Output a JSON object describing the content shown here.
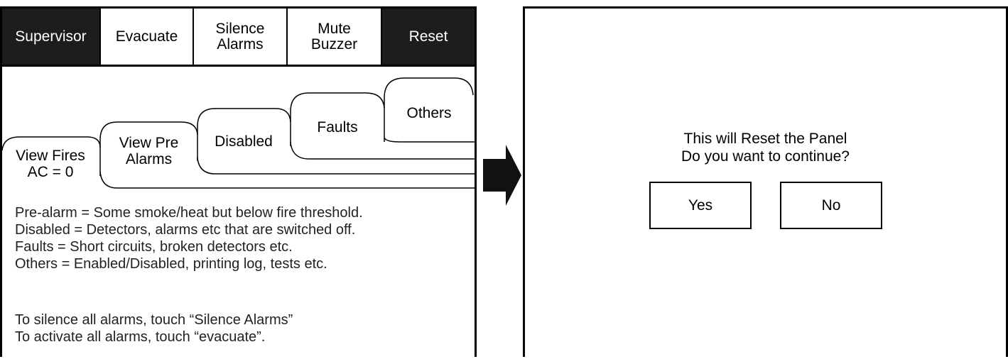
{
  "left_panel": {
    "toolbar": {
      "supervisor": "Supervisor",
      "evacuate": "Evacuate",
      "silence_alarms": "Silence\nAlarms",
      "mute_buzzer": "Mute\nBuzzer",
      "reset": "Reset"
    },
    "tabs": {
      "view_fires": "View Fires\nAC = 0",
      "view_pre_alarms": "View Pre\nAlarms",
      "disabled": "Disabled",
      "faults": "Faults",
      "others": "Others"
    },
    "descriptions": [
      "Pre-alarm = Some smoke/heat but below fire threshold.",
      "Disabled = Detectors, alarms etc that are switched off.",
      "Faults = Short circuits, broken detectors etc.",
      "Others = Enabled/Disabled, printing log, tests etc."
    ],
    "instructions": [
      "To silence all alarms, touch “Silence Alarms”",
      "To activate all alarms, touch “evacuate”."
    ]
  },
  "arrow_icon": "right-arrow-icon",
  "right_panel": {
    "message_line1": "This will Reset the Panel",
    "message_line2": "Do you want to continue?",
    "yes_label": "Yes",
    "no_label": "No"
  }
}
